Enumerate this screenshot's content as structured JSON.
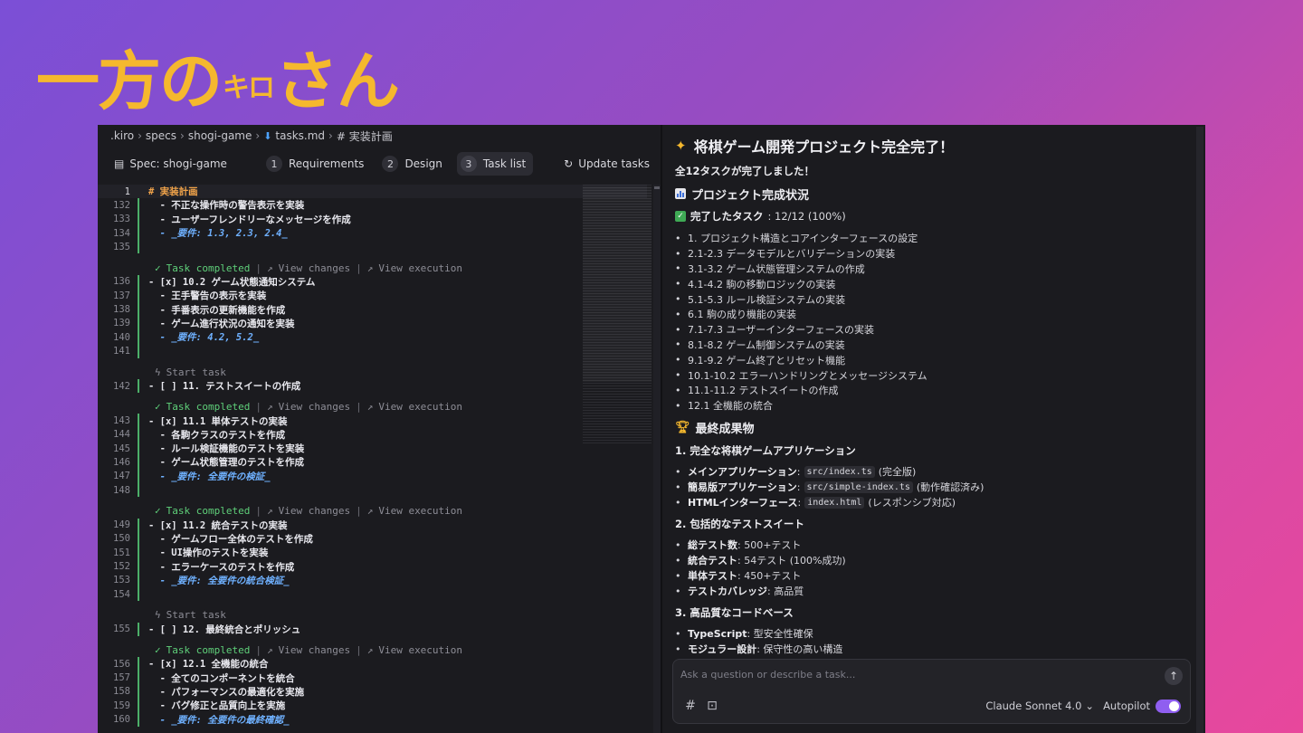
{
  "brand": {
    "text_main": "一方の",
    "text_sup": "キロ",
    "text_end": "さん"
  },
  "breadcrumb": {
    "items": [
      ".kiro",
      "specs",
      "shogi-game",
      "tasks.md",
      "# 実装計画"
    ]
  },
  "spec_bar": {
    "label": "Spec: shogi-game",
    "tabs": [
      {
        "num": "1",
        "label": "Requirements",
        "active": false
      },
      {
        "num": "2",
        "label": "Design",
        "active": false
      },
      {
        "num": "3",
        "label": "Task list",
        "active": true
      }
    ],
    "update_label": "Update tasks"
  },
  "code": {
    "task_completed": "Task completed",
    "view_changes": "View changes",
    "view_execution": "View execution",
    "start_task": "Start task",
    "lines": [
      {
        "n": "1",
        "t": "# 実装計画",
        "k": "hash"
      },
      {
        "n": "132",
        "t": "  - 不正な操作時の警告表示を実装",
        "k": "txt"
      },
      {
        "n": "133",
        "t": "  - ユーザーフレンドリーなメッセージを作成",
        "k": "txt"
      },
      {
        "n": "134",
        "t": "  - _要件: 1.3, 2.3, 2.4_",
        "k": "req"
      },
      {
        "n": "135",
        "t": "",
        "k": "txt"
      },
      {
        "lens": "completed"
      },
      {
        "n": "136",
        "t": "- [x] 10.2 ゲーム状態通知システム",
        "k": "txt"
      },
      {
        "n": "137",
        "t": "  - 王手警告の表示を実装",
        "k": "txt"
      },
      {
        "n": "138",
        "t": "  - 手番表示の更新機能を作成",
        "k": "txt"
      },
      {
        "n": "139",
        "t": "  - ゲーム進行状況の通知を実装",
        "k": "txt"
      },
      {
        "n": "140",
        "t": "  - _要件: 4.2, 5.2_",
        "k": "req"
      },
      {
        "n": "141",
        "t": "",
        "k": "txt"
      },
      {
        "lens": "start"
      },
      {
        "n": "142",
        "t": "- [ ] 11. テストスイートの作成",
        "k": "txt"
      },
      {
        "lens": "completed"
      },
      {
        "n": "143",
        "t": "- [x] 11.1 単体テストの実装",
        "k": "txt"
      },
      {
        "n": "144",
        "t": "  - 各駒クラスのテストを作成",
        "k": "txt"
      },
      {
        "n": "145",
        "t": "  - ルール検証機能のテストを実装",
        "k": "txt"
      },
      {
        "n": "146",
        "t": "  - ゲーム状態管理のテストを作成",
        "k": "txt"
      },
      {
        "n": "147",
        "t": "  - _要件: 全要件の検証_",
        "k": "req"
      },
      {
        "n": "148",
        "t": "",
        "k": "txt"
      },
      {
        "lens": "completed"
      },
      {
        "n": "149",
        "t": "- [x] 11.2 統合テストの実装",
        "k": "txt"
      },
      {
        "n": "150",
        "t": "  - ゲームフロー全体のテストを作成",
        "k": "txt"
      },
      {
        "n": "151",
        "t": "  - UI操作のテストを実装",
        "k": "txt"
      },
      {
        "n": "152",
        "t": "  - エラーケースのテストを作成",
        "k": "txt"
      },
      {
        "n": "153",
        "t": "  - _要件: 全要件の統合検証_",
        "k": "req"
      },
      {
        "n": "154",
        "t": "",
        "k": "txt"
      },
      {
        "lens": "start"
      },
      {
        "n": "155",
        "t": "- [ ] 12. 最終統合とポリッシュ",
        "k": "txt"
      },
      {
        "lens": "completed"
      },
      {
        "n": "156",
        "t": "- [x] 12.1 全機能の統合",
        "k": "txt"
      },
      {
        "n": "157",
        "t": "  - 全てのコンポーネントを統合",
        "k": "txt"
      },
      {
        "n": "158",
        "t": "  - パフォーマンスの最適化を実施",
        "k": "txt"
      },
      {
        "n": "159",
        "t": "  - バグ修正と品質向上を実施",
        "k": "txt"
      },
      {
        "n": "160",
        "t": "  - _要件: 全要件の最終確認_",
        "k": "req"
      }
    ]
  },
  "chat": {
    "title": "将棋ゲーム開発プロジェクト完全完了！",
    "all_done": "全12タスクが完了しました！",
    "status_heading": "プロジェクト完成状況",
    "completed_label": "完了したタスク",
    "completed_value": ": 12/12 (100%)",
    "tasks": [
      "1. プロジェクト構造とコアインターフェースの設定",
      "2.1-2.3 データモデルとバリデーションの実装",
      "3.1-3.2 ゲーム状態管理システムの作成",
      "4.1-4.2 駒の移動ロジックの実装",
      "5.1-5.3 ルール検証システムの実装",
      "6.1 駒の成り機能の実装",
      "7.1-7.3 ユーザーインターフェースの実装",
      "8.1-8.2 ゲーム制御システムの実装",
      "9.1-9.2 ゲーム終了とリセット機能",
      "10.1-10.2 エラーハンドリングとメッセージシステム",
      "11.1-11.2 テストスイートの作成",
      "12.1 全機能の統合"
    ],
    "deliverables_heading": "最終成果物",
    "sec1_title": "1. 完全な将棋ゲームアプリケーション",
    "sec1_items": [
      {
        "b": "メインアプリケーション",
        "code": "src/index.ts",
        "after": "(完全版)"
      },
      {
        "b": "簡易版アプリケーション",
        "code": "src/simple-index.ts",
        "after": "(動作確認済み)"
      },
      {
        "b": "HTMLインターフェース",
        "code": "index.html",
        "after": "(レスポンシブ対応)"
      }
    ],
    "sec2_title": "2. 包括的なテストスイート",
    "sec2_items": [
      {
        "b": "総テスト数",
        "after": ": 500+テスト"
      },
      {
        "b": "統合テスト",
        "after": ": 54テスト (100%成功)"
      },
      {
        "b": "単体テスト",
        "after": ": 450+テスト"
      },
      {
        "b": "テストカバレッジ",
        "after": ": 高品質"
      }
    ],
    "sec3_title": "3. 高品質なコードベース",
    "sec3_items": [
      {
        "b": "TypeScript",
        "after": ": 型安全性確保"
      },
      {
        "b": "モジュラー設計",
        "after": ": 保守性の高い構造"
      }
    ],
    "input_placeholder": "Ask a question or describe a task...",
    "model": "Claude Sonnet 4.0",
    "autopilot": "Autopilot"
  }
}
